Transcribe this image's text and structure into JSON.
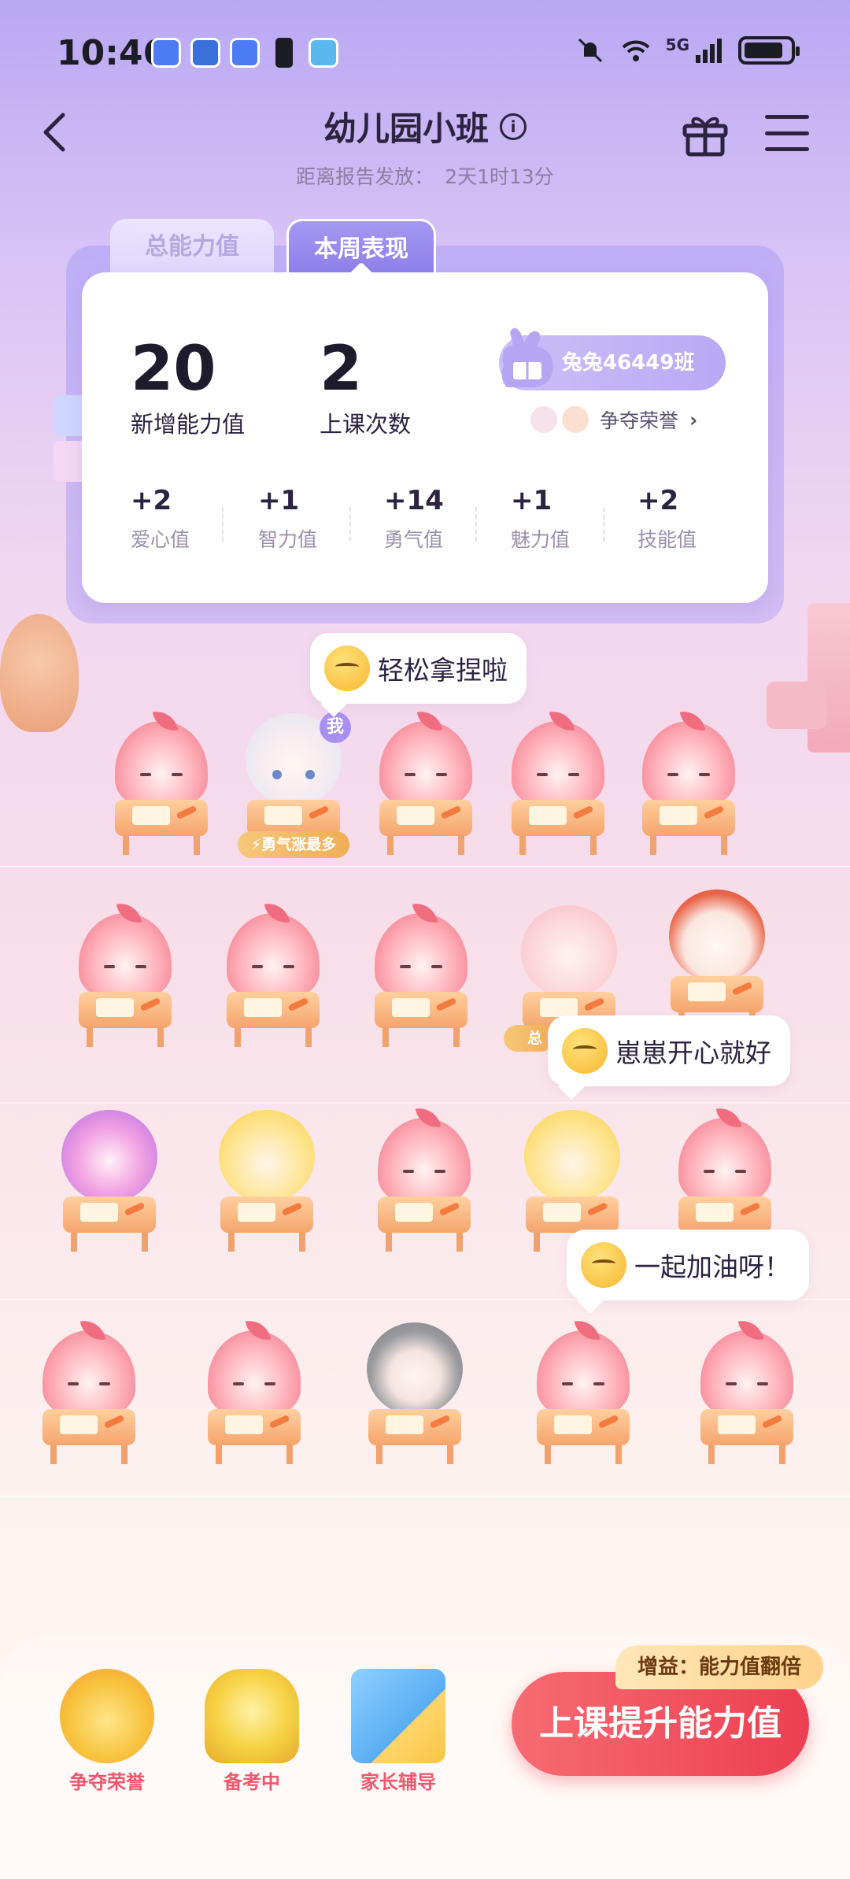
{
  "status_bar": {
    "time": "10:46",
    "network": "5G",
    "battery_level": 0.85
  },
  "header": {
    "title": "幼儿园小班",
    "countdown_label": "距离报告发放：",
    "countdown_value": "2天1时13分",
    "icons": [
      "back-icon",
      "info-icon",
      "gift-icon",
      "menu-icon"
    ]
  },
  "tabs": [
    {
      "label": "总能力值",
      "active": false
    },
    {
      "label": "本周表现",
      "active": true
    }
  ],
  "card": {
    "new_ability": {
      "value": "20",
      "label": "新增能力值"
    },
    "class_count": {
      "value": "2",
      "label": "上课次数"
    },
    "class_name": "兔兔46449班",
    "honor_link": "争夺荣誉",
    "deltas": [
      {
        "value": "+2",
        "label": "爱心值"
      },
      {
        "value": "+1",
        "label": "智力值"
      },
      {
        "value": "+14",
        "label": "勇气值"
      },
      {
        "value": "+1",
        "label": "魅力值"
      },
      {
        "value": "+2",
        "label": "技能值"
      }
    ]
  },
  "classroom": {
    "me_badge": "我",
    "courage_tag": "勇气涨最多",
    "small_tag": "总",
    "bubbles": [
      "轻松拿捏啦",
      "崽崽开心就好",
      "一起加油呀！"
    ]
  },
  "dock": {
    "items": [
      {
        "label": "争夺荣誉",
        "icon": "honor-icon"
      },
      {
        "label": "备考中",
        "icon": "trophy-icon"
      },
      {
        "label": "家长辅导",
        "icon": "book-icon"
      }
    ],
    "boost_label": "增益：能力值翻倍",
    "cta_label": "上课提升能力值"
  },
  "colors": {
    "accent": "#ec3f52",
    "tab_active": "#8c7fe8",
    "label_red": "#f2566e"
  }
}
